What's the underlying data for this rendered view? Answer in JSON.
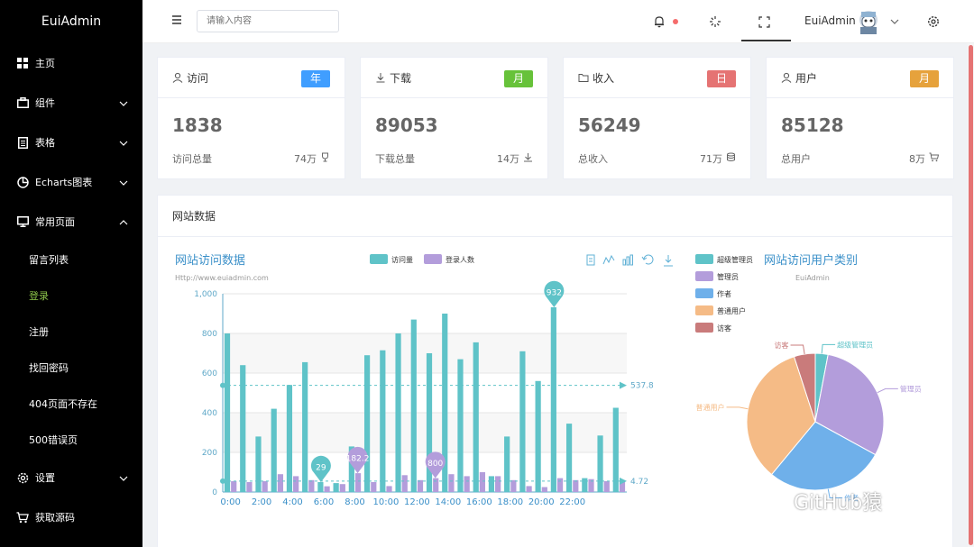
{
  "sidebar": {
    "brand": "EuiAdmin",
    "items": [
      {
        "label": "主页"
      },
      {
        "label": "组件"
      },
      {
        "label": "表格"
      },
      {
        "label": "Echarts图表"
      },
      {
        "label": "常用页面"
      }
    ],
    "subitems": [
      {
        "label": "留言列表"
      },
      {
        "label": "登录"
      },
      {
        "label": "注册"
      },
      {
        "label": "找回密码"
      },
      {
        "label": "404页面不存在"
      },
      {
        "label": "500错误页"
      }
    ],
    "bottom_items": [
      {
        "label": "设置"
      },
      {
        "label": "获取源码"
      }
    ]
  },
  "header": {
    "search_placeholder": "请输入内容",
    "username": "EuiAdmin"
  },
  "cards": [
    {
      "title": "访问",
      "badge": "年",
      "badge_color": "#409eff",
      "value": "1838",
      "sub": "访问总量",
      "total": "74万"
    },
    {
      "title": "下载",
      "badge": "月",
      "badge_color": "#67c23a",
      "value": "89053",
      "sub": "下载总量",
      "total": "14万"
    },
    {
      "title": "收入",
      "badge": "日",
      "badge_color": "#e57373",
      "value": "56249",
      "sub": "总收入",
      "total": "71万"
    },
    {
      "title": "用户",
      "badge": "月",
      "badge_color": "#e6a23c",
      "value": "85128",
      "sub": "总用户",
      "total": "8万"
    }
  ],
  "panel": {
    "title": "网站数据"
  },
  "chart_data": [
    {
      "type": "bar",
      "title": "网站访问数据",
      "subtitle": "Http://www.euiadmin.com",
      "legend": [
        "访问量",
        "登录人数"
      ],
      "colors": [
        "#5fc3c8",
        "#b39ddb"
      ],
      "ylim": [
        0,
        1000
      ],
      "yticks": [
        "0",
        "200",
        "400",
        "600",
        "800",
        "1,000"
      ],
      "x_tick_labels": [
        "0:00",
        "2:00",
        "4:00",
        "6:00",
        "8:00",
        "10:00",
        "12:00",
        "14:00",
        "16:00",
        "18:00",
        "20:00",
        "22:00"
      ],
      "series": [
        {
          "name": "访问量",
          "values": [
            800,
            640,
            280,
            420,
            540,
            655,
            50,
            45,
            230,
            690,
            715,
            800,
            870,
            700,
            900,
            670,
            755,
            80,
            280,
            710,
            560,
            932,
            345,
            70,
            285,
            425
          ]
        },
        {
          "name": "登录人数",
          "values": [
            55,
            50,
            55,
            90,
            80,
            60,
            29,
            40,
            95,
            50,
            30,
            85,
            60,
            70,
            90,
            80,
            100,
            80,
            60,
            30,
            25,
            70,
            60,
            65,
            55,
            60
          ]
        }
      ],
      "markpoints": [
        {
          "label": "932",
          "index": 21,
          "series": 0
        },
        {
          "label": "29",
          "index": 6,
          "series": 0
        },
        {
          "label": "182.2",
          "index": 8,
          "series": 1
        },
        {
          "label": "800",
          "index": 13,
          "series": 1
        }
      ],
      "marklines": [
        {
          "label": "537.8",
          "value": 537.8
        },
        {
          "label": "4.72",
          "value": 55
        }
      ]
    },
    {
      "type": "pie",
      "title": "网站访问用户类别",
      "subtitle": "EuiAdmin",
      "legend": [
        "超级管理员",
        "管理员",
        "作者",
        "普通用户",
        "访客"
      ],
      "slices": [
        {
          "name": "超级管理员",
          "value": 3,
          "color": "#5fc3c8"
        },
        {
          "name": "管理员",
          "value": 30,
          "color": "#b39ddb"
        },
        {
          "name": "作者",
          "value": 28,
          "color": "#6fb0ea"
        },
        {
          "name": "普通用户",
          "value": 34,
          "color": "#f5bb86"
        },
        {
          "name": "访客",
          "value": 5,
          "color": "#c97b7b"
        }
      ]
    }
  ],
  "watermark": "GitHub猿"
}
